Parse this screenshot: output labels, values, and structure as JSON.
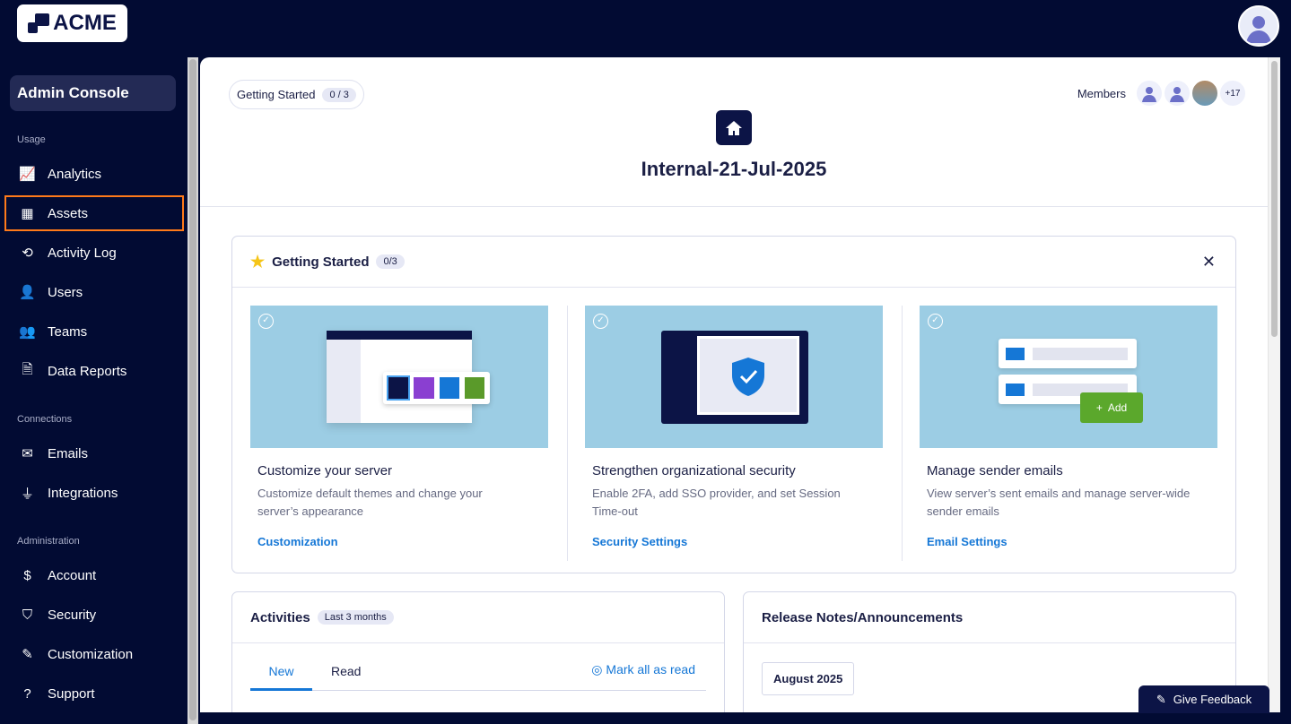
{
  "brand": "ACME",
  "sidebar": {
    "title": "Admin Console",
    "sections": [
      {
        "label": "Usage",
        "items": [
          {
            "label": "Analytics",
            "icon": "📈"
          },
          {
            "label": "Assets",
            "icon": "▦"
          },
          {
            "label": "Activity Log",
            "icon": "⟲"
          },
          {
            "label": "Users",
            "icon": "👤"
          },
          {
            "label": "Teams",
            "icon": "👥"
          },
          {
            "label": "Data Reports",
            "icon": "🗎"
          }
        ]
      },
      {
        "label": "Connections",
        "items": [
          {
            "label": "Emails",
            "icon": "✉"
          },
          {
            "label": "Integrations",
            "icon": "⏚"
          }
        ]
      },
      {
        "label": "Administration",
        "items": [
          {
            "label": "Account",
            "icon": "$"
          },
          {
            "label": "Security",
            "icon": "⛉"
          },
          {
            "label": "Customization",
            "icon": "✎"
          },
          {
            "label": "Support",
            "icon": "?"
          }
        ]
      }
    ]
  },
  "header": {
    "gs_label": "Getting Started",
    "gs_count": "0 / 3",
    "members_label": "Members",
    "members_more": "+17",
    "title": "Internal-21-Jul-2025"
  },
  "getting_started": {
    "title": "Getting Started",
    "count": "0/3",
    "cards": [
      {
        "title": "Customize your server",
        "desc": "Customize default themes and change your server’s appearance",
        "link": "Customization"
      },
      {
        "title": "Strengthen organizational security",
        "desc": "Enable 2FA, add SSO provider, and set Session Time-out",
        "link": "Security Settings"
      },
      {
        "title": "Manage sender emails",
        "desc": "View server’s sent emails and manage server-wide sender emails",
        "link": "Email Settings",
        "add_label": "Add"
      }
    ]
  },
  "activities": {
    "title": "Activities",
    "range": "Last 3 months",
    "tabs": [
      "New",
      "Read"
    ],
    "mark_all": "Mark all as read"
  },
  "release": {
    "title": "Release Notes/Announcements",
    "month": "August 2025"
  },
  "feedback": "Give Feedback"
}
